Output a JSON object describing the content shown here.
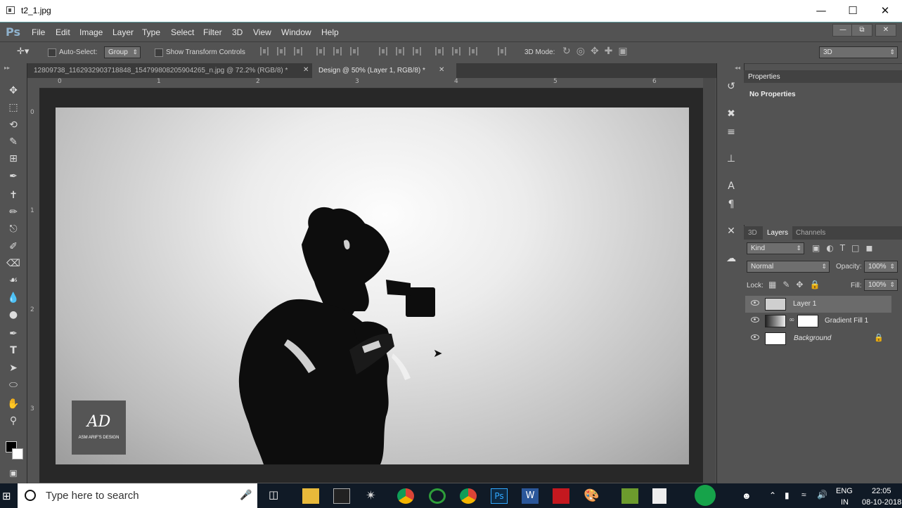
{
  "window": {
    "title": "t2_1.jpg",
    "min": "—",
    "max": "☐",
    "close": "✕"
  },
  "app": {
    "logo": "Ps"
  },
  "menu": [
    "File",
    "Edit",
    "Image",
    "Layer",
    "Type",
    "Select",
    "Filter",
    "3D",
    "View",
    "Window",
    "Help"
  ],
  "options": {
    "auto_select_label": "Auto-Select:",
    "group_value": "Group",
    "show_transform_label": "Show Transform Controls",
    "mode_label": "3D Mode:",
    "workspace_value": "3D"
  },
  "tabs": [
    {
      "label": "12809738_1162932903718848_1547998082059042​65_n.jpg @ 72.2% (RGB/8) *"
    },
    {
      "label": "Design @ 50% (Layer 1, RGB/8) *"
    }
  ],
  "ruler": {
    "h": [
      "0",
      "1",
      "2",
      "3",
      "4",
      "5",
      "6"
    ],
    "v": [
      "0",
      "1",
      "2",
      "3"
    ]
  },
  "watermark": {
    "mono": "AD",
    "text": "ASM ARIF'S DESIGN"
  },
  "properties": {
    "title": "Properties",
    "body": "No Properties"
  },
  "layers_panel": {
    "tabs": [
      "3D",
      "Layers",
      "Channels"
    ],
    "filter": "Kind",
    "blend": "Normal",
    "opacity_label": "Opacity:",
    "opacity": "100%",
    "lock_label": "Lock:",
    "fill_label": "Fill:",
    "fill": "100%",
    "layers": [
      {
        "name": "Layer 1"
      },
      {
        "name": "Gradient Fill 1"
      },
      {
        "name": "Background"
      }
    ]
  },
  "taskbar": {
    "search_placeholder": "Type here to search",
    "lang": "ENG",
    "region": "IN",
    "time": "22:05",
    "date": "08-10-2018"
  }
}
